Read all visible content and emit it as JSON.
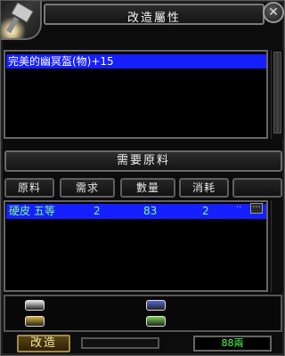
{
  "window": {
    "title": "改造屬性"
  },
  "result_list": {
    "items": [
      {
        "label": "完美的幽冥盔(物)+15"
      }
    ]
  },
  "materials": {
    "header": "需要原料",
    "columns": [
      "原料",
      "需求",
      "數量",
      "消耗"
    ],
    "rows": [
      {
        "name": "硬皮 五等",
        "need": "2",
        "count": "83",
        "consume": "2"
      }
    ],
    "row_button": "⋯"
  },
  "gems": [
    {
      "color": "#e8e8e8"
    },
    {
      "color": "#5a66d8"
    },
    {
      "color": "#d9b63a"
    },
    {
      "color": "#7ad24a"
    }
  ],
  "footer": {
    "apply_label": "改造",
    "money": "88兩"
  },
  "icons": {
    "portrait": "enhancement-portrait-icon",
    "close": "close-icon",
    "item_detail": "more-button-icon"
  }
}
